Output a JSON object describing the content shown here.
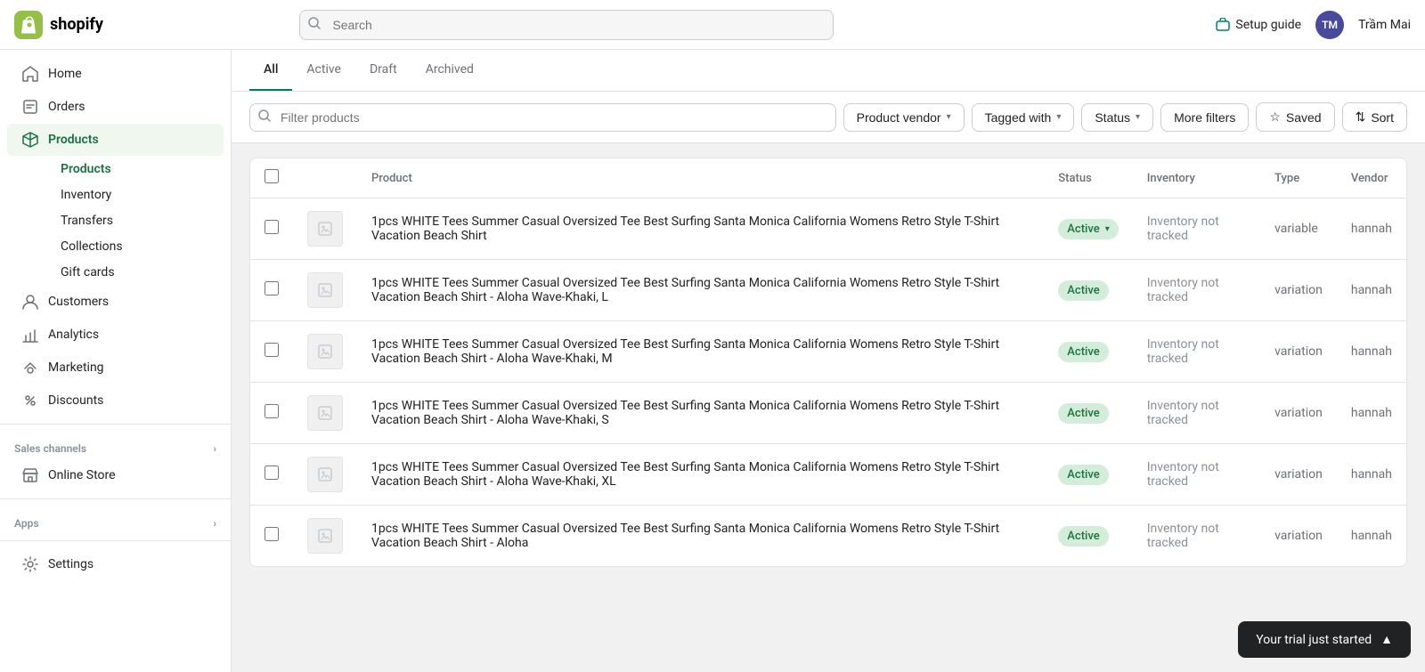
{
  "topbar": {
    "logo_text": "shopify",
    "search_placeholder": "Search",
    "setup_guide_label": "Setup guide",
    "user_initials": "TM",
    "user_name": "Trầm Mai"
  },
  "sidebar": {
    "items": [
      {
        "id": "home",
        "label": "Home",
        "icon": "home-icon"
      },
      {
        "id": "orders",
        "label": "Orders",
        "icon": "orders-icon"
      },
      {
        "id": "products",
        "label": "Products",
        "icon": "products-icon",
        "active": true
      },
      {
        "id": "customers",
        "label": "Customers",
        "icon": "customers-icon"
      },
      {
        "id": "analytics",
        "label": "Analytics",
        "icon": "analytics-icon"
      },
      {
        "id": "marketing",
        "label": "Marketing",
        "icon": "marketing-icon"
      },
      {
        "id": "discounts",
        "label": "Discounts",
        "icon": "discounts-icon"
      }
    ],
    "products_sub": [
      {
        "id": "all-products",
        "label": "Products",
        "active": true
      },
      {
        "id": "inventory",
        "label": "Inventory"
      },
      {
        "id": "transfers",
        "label": "Transfers"
      },
      {
        "id": "collections",
        "label": "Collections"
      },
      {
        "id": "gift-cards",
        "label": "Gift cards"
      }
    ],
    "sales_channels_label": "Sales channels",
    "sales_channels_items": [
      {
        "id": "online-store",
        "label": "Online Store",
        "icon": "store-icon"
      }
    ],
    "apps_label": "Apps",
    "settings_label": "Settings",
    "settings_icon": "settings-icon"
  },
  "tabs": [
    {
      "id": "all",
      "label": "All",
      "active": true
    },
    {
      "id": "active",
      "label": "Active"
    },
    {
      "id": "draft",
      "label": "Draft"
    },
    {
      "id": "archived",
      "label": "Archived"
    }
  ],
  "filters": {
    "search_placeholder": "Filter products",
    "product_vendor_label": "Product vendor",
    "tagged_with_label": "Tagged with",
    "status_label": "Status",
    "more_filters_label": "More filters",
    "saved_label": "Saved",
    "sort_label": "Sort"
  },
  "table": {
    "columns": [
      {
        "id": "product",
        "label": "Product"
      },
      {
        "id": "status",
        "label": "Status"
      },
      {
        "id": "inventory",
        "label": "Inventory"
      },
      {
        "id": "type",
        "label": "Type"
      },
      {
        "id": "vendor",
        "label": "Vendor"
      }
    ],
    "rows": [
      {
        "id": 1,
        "product": "1pcs WHITE Tees Summer Casual Oversized Tee Best Surfing Santa Monica California Womens Retro Style T-Shirt Vacation Beach Shirt",
        "status": "Active",
        "status_has_dropdown": true,
        "inventory": "Inventory not tracked",
        "type": "variable",
        "vendor": "hannah"
      },
      {
        "id": 2,
        "product": "1pcs WHITE Tees Summer Casual Oversized Tee Best Surfing Santa Monica California Womens Retro Style T-Shirt Vacation Beach Shirt - Aloha Wave-Khaki, L",
        "status": "Active",
        "status_has_dropdown": false,
        "inventory": "Inventory not tracked",
        "type": "variation",
        "vendor": "hannah"
      },
      {
        "id": 3,
        "product": "1pcs WHITE Tees Summer Casual Oversized Tee Best Surfing Santa Monica California Womens Retro Style T-Shirt Vacation Beach Shirt - Aloha Wave-Khaki, M",
        "status": "Active",
        "status_has_dropdown": false,
        "inventory": "Inventory not tracked",
        "type": "variation",
        "vendor": "hannah"
      },
      {
        "id": 4,
        "product": "1pcs WHITE Tees Summer Casual Oversized Tee Best Surfing Santa Monica California Womens Retro Style T-Shirt Vacation Beach Shirt - Aloha Wave-Khaki, S",
        "status": "Active",
        "status_has_dropdown": false,
        "inventory": "Inventory not tracked",
        "type": "variation",
        "vendor": "hannah"
      },
      {
        "id": 5,
        "product": "1pcs WHITE Tees Summer Casual Oversized Tee Best Surfing Santa Monica California Womens Retro Style T-Shirt Vacation Beach Shirt - Aloha Wave-Khaki, XL",
        "status": "Active",
        "status_has_dropdown": false,
        "inventory": "Inventory not tracked",
        "type": "variation",
        "vendor": "hannah"
      },
      {
        "id": 6,
        "product": "1pcs WHITE Tees Summer Casual Oversized Tee Best Surfing Santa Monica California Womens Retro Style T-Shirt Vacation Beach Shirt - Aloha",
        "status": "Active",
        "status_has_dropdown": false,
        "inventory": "Inventory not tracked",
        "type": "variation",
        "vendor": "hannah"
      }
    ]
  },
  "trial_banner": {
    "text": "Your trial just started",
    "icon": "chevron-up-icon"
  }
}
